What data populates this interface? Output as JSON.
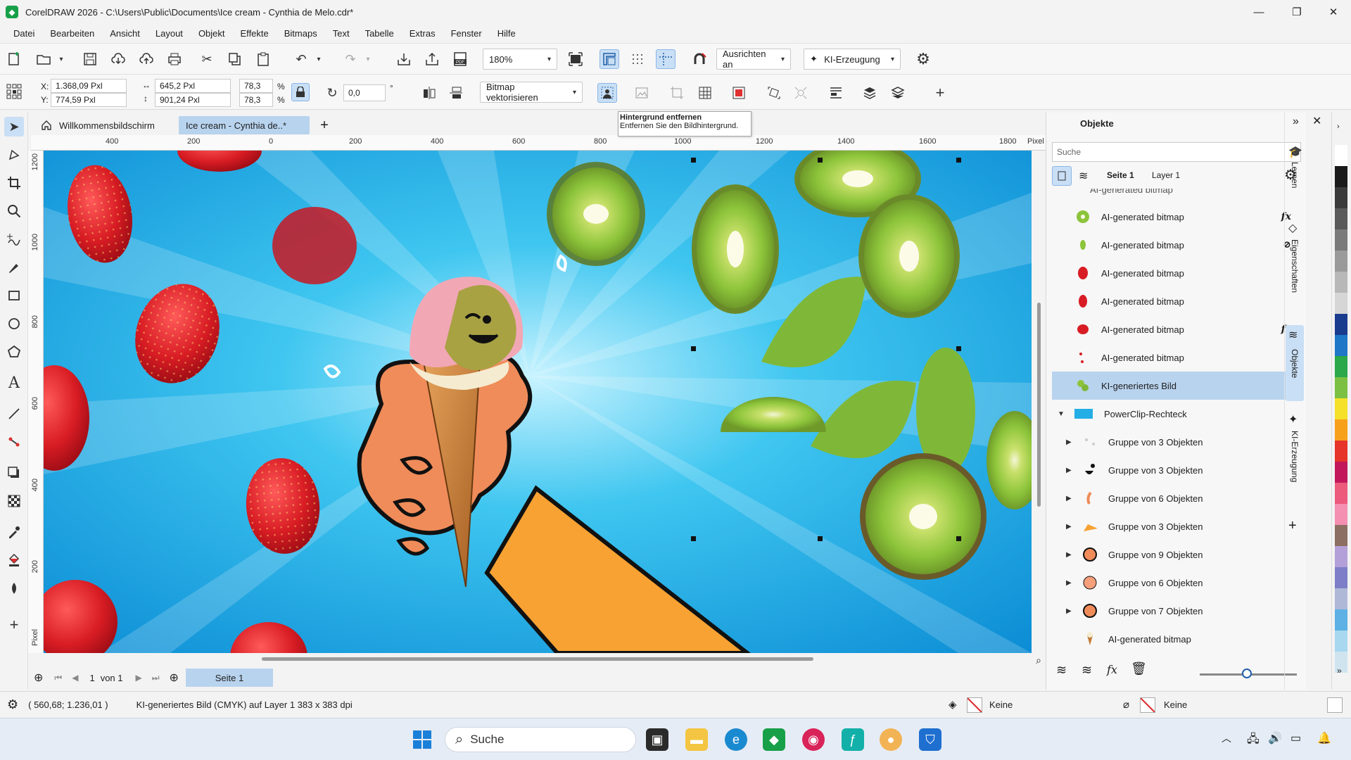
{
  "window": {
    "title": "CorelDRAW 2026 - C:\\Users\\Public\\Documents\\Ice cream - Cynthia de Melo.cdr*",
    "minimize": "—",
    "maximize": "❐",
    "close": "✕"
  },
  "menu": [
    "Datei",
    "Bearbeiten",
    "Ansicht",
    "Layout",
    "Objekt",
    "Effekte",
    "Bitmaps",
    "Text",
    "Tabelle",
    "Extras",
    "Fenster",
    "Hilfe"
  ],
  "toolbar": {
    "zoom": "180%",
    "snap_label": "Ausrichten an",
    "ai_label": "KI-Erzeugung"
  },
  "property_bar": {
    "x": "1.368,09 Pxl",
    "y": "774,59 Pxl",
    "x_label": "X:",
    "y_label": "Y:",
    "width": "645,2 Pxl",
    "height": "901,24 Pxl",
    "scale_w": "78,3",
    "scale_h": "78,3",
    "percent": "%",
    "rotation": "0,0",
    "degree": "°",
    "trace_label": "Bitmap vektorisieren"
  },
  "tooltip": {
    "title": "Hintergrund entfernen",
    "text": "Entfernen Sie den Bildhintergrund."
  },
  "tabs": {
    "welcome": "Willkommensbildschirm",
    "document": "Ice cream - Cynthia de..*",
    "add": "+"
  },
  "ruler": {
    "h_ticks": [
      "400",
      "200",
      "0",
      "200",
      "400",
      "600",
      "800",
      "1000",
      "1200",
      "1400",
      "1600",
      "1800"
    ],
    "unit": "Pixel",
    "v_ticks": [
      "1200",
      "1000",
      "800",
      "600",
      "400",
      "200"
    ],
    "v_unit": "Pixel"
  },
  "page_nav": {
    "current": "1",
    "of": "von 1",
    "page_tab": "Seite 1"
  },
  "docker": {
    "title": "Objekte",
    "search_placeholder": "Suche",
    "page": "Seite 1",
    "layer": "Layer 1",
    "partial_row": "AI-generated bitmap",
    "rows": [
      {
        "label": "AI-generated bitmap",
        "thumb": "kiwi",
        "badge": "fx"
      },
      {
        "label": "AI-generated bitmap",
        "thumb": "kiwi-small",
        "badge": "hidden"
      },
      {
        "label": "AI-generated bitmap",
        "thumb": "strawberry",
        "badge": ""
      },
      {
        "label": "AI-generated bitmap",
        "thumb": "strawberry",
        "badge": ""
      },
      {
        "label": "AI-generated bitmap",
        "thumb": "strawberry",
        "badge": "fx"
      },
      {
        "label": "AI-generated bitmap",
        "thumb": "strawberry-small",
        "badge": ""
      },
      {
        "label": "KI-generiertes Bild",
        "thumb": "kiwi-group",
        "badge": "",
        "selected": true
      }
    ],
    "powerclip": "PowerClip-Rechteck",
    "groups": [
      {
        "label": "Gruppe von 3 Objekten",
        "thumb": "drops"
      },
      {
        "label": "Gruppe von 3 Objekten",
        "thumb": "face"
      },
      {
        "label": "Gruppe von 6 Objekten",
        "thumb": "finger"
      },
      {
        "label": "Gruppe von 3 Objekten",
        "thumb": "sleeve"
      },
      {
        "label": "Gruppe von 9 Objekten",
        "thumb": "hand"
      },
      {
        "label": "Gruppe von 6 Objekten",
        "thumb": "hand"
      },
      {
        "label": "Gruppe von 7 Objekten",
        "thumb": "hand"
      }
    ],
    "last_row": "AI-generated bitmap",
    "side_tabs": [
      "Lernen",
      "Eigenschaften",
      "Objekte",
      "KI-Erzeugung"
    ]
  },
  "status": {
    "coords": "( 560,68; 1.236,01 )",
    "info": "KI-generiertes Bild (CMYK) auf Layer 1  383 x 383 dpi",
    "fill": "Keine",
    "outline": "Keine"
  },
  "taskbar": {
    "search": "Suche"
  },
  "palette": [
    "#ffffff",
    "#1a1a1a",
    "#3a3a3a",
    "#5a5a5a",
    "#7a7a7a",
    "#9a9a9a",
    "#b8b8b8",
    "#d6d6d6",
    "#1a3c8f",
    "#1f77c8",
    "#2aa84a",
    "#7bc043",
    "#f5e12a",
    "#f7a01c",
    "#e6342a",
    "#c2185b",
    "#ec5a7c",
    "#f48fb1",
    "#8d6e63",
    "#b3a0d8",
    "#7e7ec8",
    "#b0b8d8",
    "#5db1e4",
    "#a8d8f0",
    "#d0e4f0"
  ]
}
